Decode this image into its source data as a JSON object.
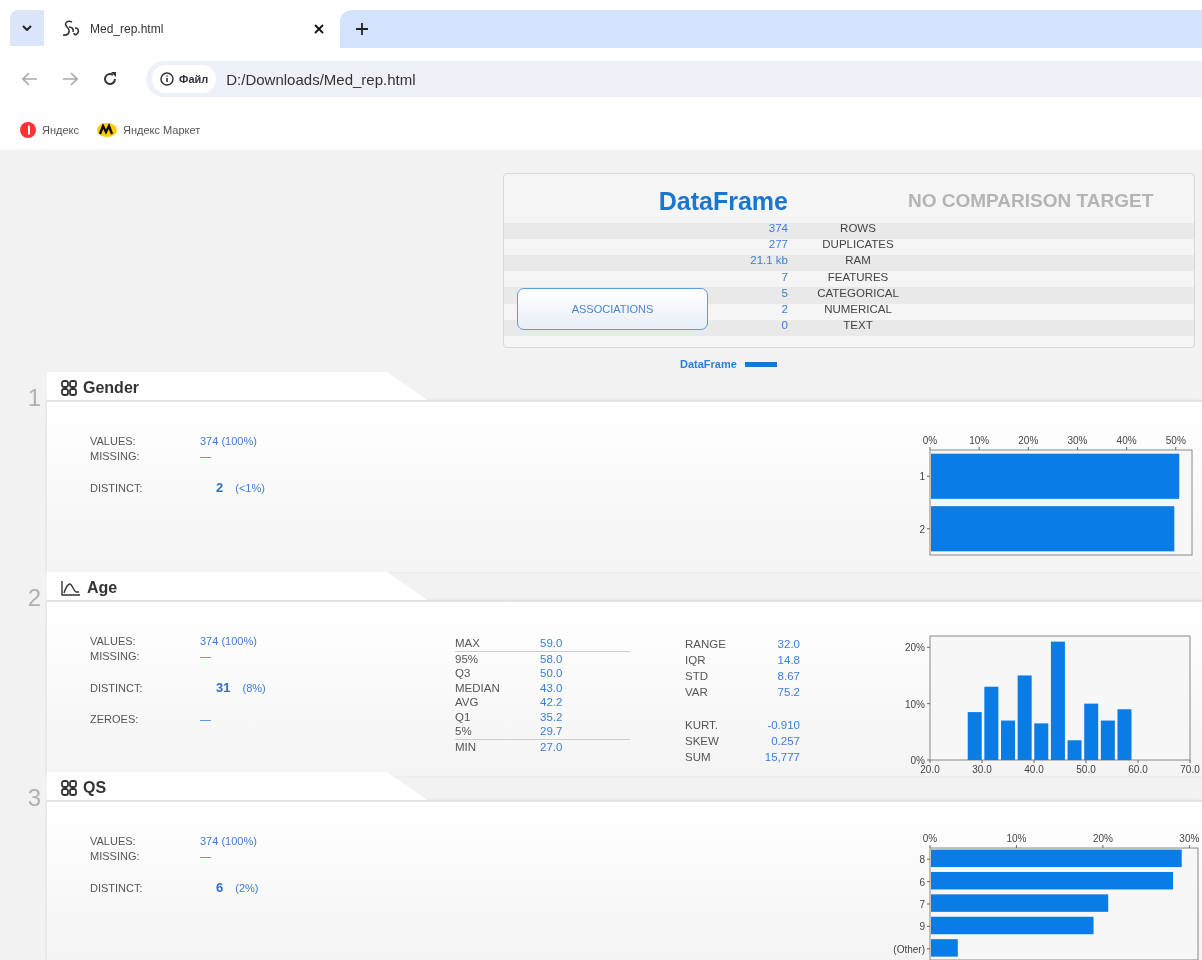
{
  "browser": {
    "tab_title": "Med_rep.html",
    "address_label": "Файл",
    "address": "D:/Downloads/Med_rep.html",
    "bookmarks": [
      {
        "label": "Яндекс",
        "kind": "yandex"
      },
      {
        "label": "Яндекс Маркет",
        "kind": "market"
      }
    ]
  },
  "summary": {
    "title": "DataFrame",
    "comparison": "NO COMPARISON TARGET",
    "button": "ASSOCIATIONS",
    "rows": [
      {
        "value": "374",
        "label": "ROWS"
      },
      {
        "value": "277",
        "label": "DUPLICATES"
      },
      {
        "value": "21.1 kb",
        "label": "RAM"
      },
      {
        "value": "7",
        "label": "FEATURES"
      },
      {
        "value": "5",
        "label": "CATEGORICAL"
      },
      {
        "value": "2",
        "label": "NUMERICAL"
      },
      {
        "value": "0",
        "label": "TEXT"
      }
    ],
    "legend": "DataFrame"
  },
  "features": [
    {
      "number": "1",
      "name": "Gender",
      "kind": "categorical",
      "stat_groups": [
        [
          {
            "label": "VALUES:",
            "value": "374 (100%)"
          },
          {
            "label": "MISSING:",
            "value": "—"
          }
        ],
        [
          {
            "label": "DISTINCT:",
            "value": "2",
            "note": "(<1%)"
          }
        ]
      ],
      "chart_data": {
        "type": "bar",
        "orientation": "horizontal",
        "categories": [
          "1",
          "2"
        ],
        "values": [
          50.5,
          49.5
        ],
        "xlim": [
          0,
          53.3
        ],
        "xticks": [
          {
            "value": 0,
            "label": "0%"
          },
          {
            "value": 10,
            "label": "10%"
          },
          {
            "value": 20,
            "label": "20%"
          },
          {
            "value": 30,
            "label": "30%"
          },
          {
            "value": 40,
            "label": "40%"
          },
          {
            "value": 50,
            "label": "50%"
          }
        ]
      }
    },
    {
      "number": "2",
      "name": "Age",
      "kind": "numeric",
      "stat_groups": [
        [
          {
            "label": "VALUES:",
            "value": "374 (100%)"
          },
          {
            "label": "MISSING:",
            "value": "—"
          }
        ],
        [
          {
            "label": "DISTINCT:",
            "value": "31",
            "note": "(8%)"
          }
        ],
        [
          {
            "label": "ZEROES:",
            "value": "—"
          }
        ]
      ],
      "quantiles": [
        {
          "label": "MAX",
          "value": "59.0"
        },
        {
          "label": "95%",
          "value": "58.0"
        },
        {
          "label": "Q3",
          "value": "50.0"
        },
        {
          "label": "MEDIAN",
          "value": "43.0"
        },
        {
          "label": "AVG",
          "value": "42.2"
        },
        {
          "label": "Q1",
          "value": "35.2"
        },
        {
          "label": "5%",
          "value": "29.7"
        },
        {
          "label": "MIN",
          "value": "27.0"
        }
      ],
      "moment_groups": [
        [
          {
            "label": "RANGE",
            "value": "32.0"
          },
          {
            "label": "IQR",
            "value": "14.8"
          },
          {
            "label": "STD",
            "value": "8.67"
          },
          {
            "label": "VAR",
            "value": "75.2"
          }
        ],
        [
          {
            "label": "KURT.",
            "value": "-0.910"
          },
          {
            "label": "SKEW",
            "value": "0.257"
          },
          {
            "label": "SUM",
            "value": "15,777"
          }
        ]
      ],
      "chart_data": {
        "type": "bar",
        "orientation": "vertical",
        "x": [
          28.6,
          31.8,
          35.0,
          38.2,
          41.4,
          44.6,
          47.8,
          51.0,
          54.2,
          57.4
        ],
        "values": [
          8.5,
          13,
          7,
          15,
          6.5,
          21,
          3.5,
          10,
          7,
          9
        ],
        "xlim": [
          20,
          70
        ],
        "ylim": [
          0,
          22
        ],
        "xticks": [
          {
            "value": 20,
            "label": "20.0"
          },
          {
            "value": 30,
            "label": "30.0"
          },
          {
            "value": 40,
            "label": "40.0"
          },
          {
            "value": 50,
            "label": "50.0"
          },
          {
            "value": 60,
            "label": "60.0"
          },
          {
            "value": 70,
            "label": "70.0"
          }
        ],
        "yticks": [
          {
            "value": 0,
            "label": "0%"
          },
          {
            "value": 10,
            "label": "10%"
          },
          {
            "value": 20,
            "label": "20%"
          }
        ]
      }
    },
    {
      "number": "3",
      "name": "QS",
      "kind": "categorical",
      "stat_groups": [
        [
          {
            "label": "VALUES:",
            "value": "374 (100%)"
          },
          {
            "label": "MISSING:",
            "value": "—"
          }
        ],
        [
          {
            "label": "DISTINCT:",
            "value": "6",
            "note": "(2%)"
          }
        ]
      ],
      "chart_data": {
        "type": "bar",
        "orientation": "horizontal",
        "categories": [
          "8",
          "6",
          "7",
          "9",
          "(Other)"
        ],
        "values": [
          29,
          28,
          20.5,
          18.8,
          3.1
        ],
        "xlim": [
          0,
          31
        ],
        "xticks": [
          {
            "value": 0,
            "label": "0%"
          },
          {
            "value": 10,
            "label": "10%"
          },
          {
            "value": 20,
            "label": "20%"
          },
          {
            "value": 30,
            "label": "30%"
          }
        ]
      }
    }
  ]
}
